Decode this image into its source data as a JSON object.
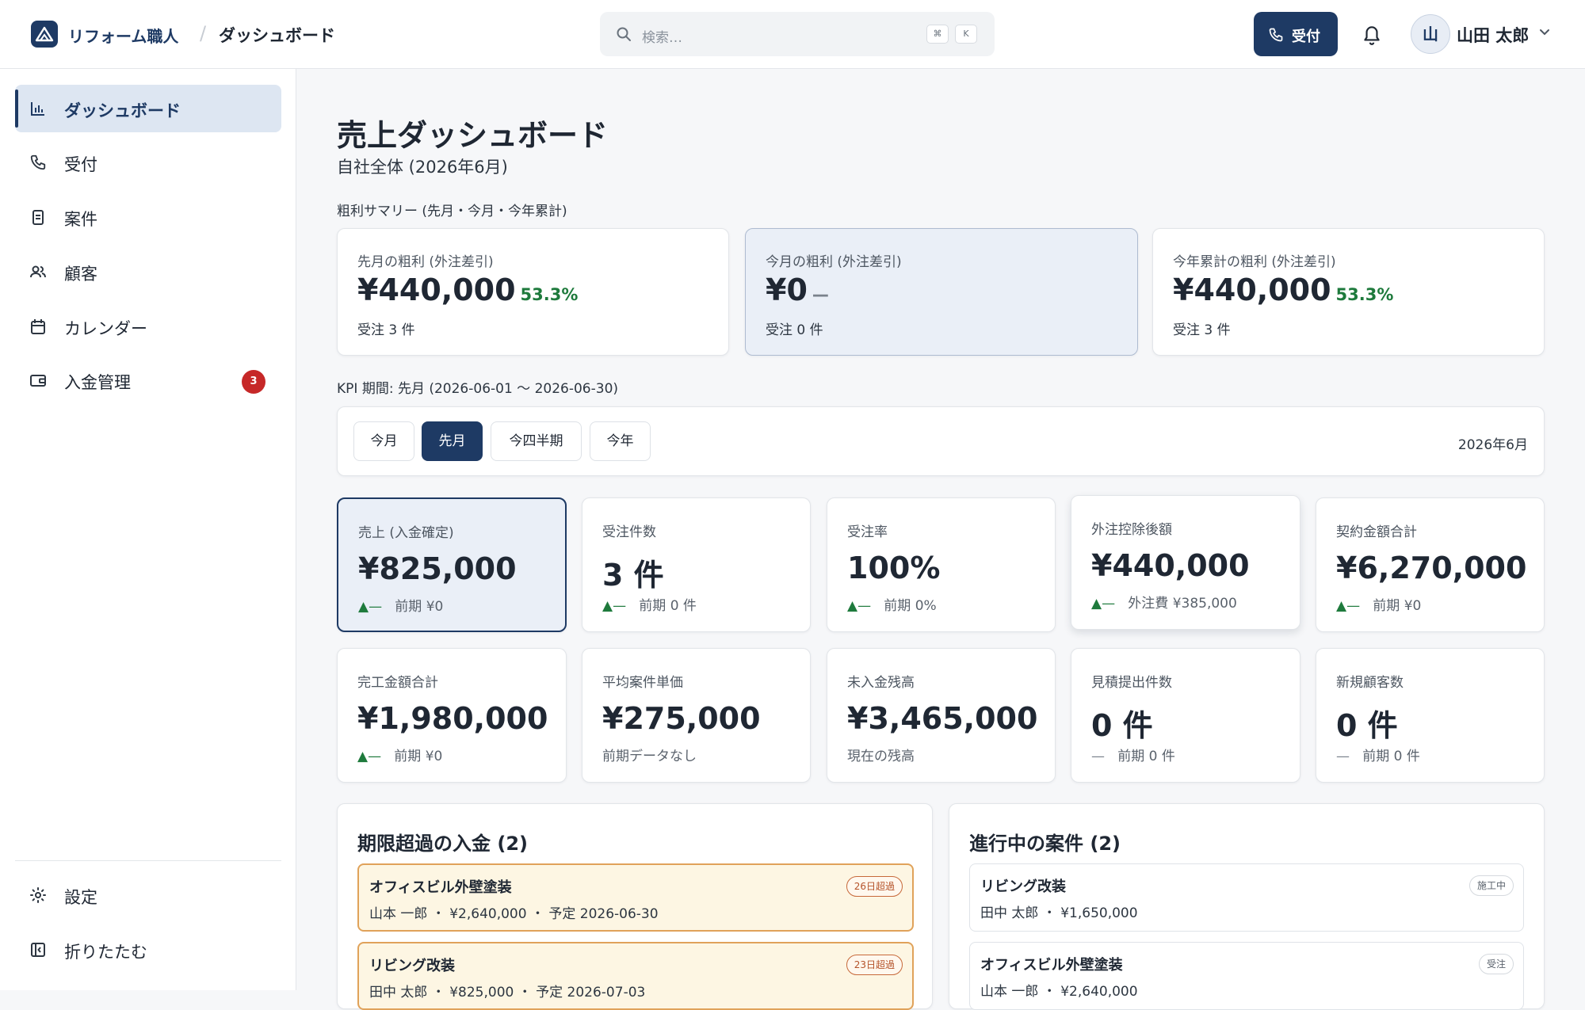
{
  "header": {
    "brand": "リフォーム職人",
    "breadcrumb_sep": "/",
    "page": "ダッシュボード",
    "search_placeholder": "検索…",
    "shortcut_key1": "⌘",
    "shortcut_key2": "K",
    "reception_label": "受付",
    "avatar_initial": "山",
    "user_name": "山田 太郎"
  },
  "sidebar": {
    "items": [
      {
        "label": "ダッシュボード",
        "icon": "bar-chart-icon"
      },
      {
        "label": "受付",
        "icon": "phone-icon"
      },
      {
        "label": "案件",
        "icon": "clipboard-icon"
      },
      {
        "label": "顧客",
        "icon": "users-icon"
      },
      {
        "label": "カレンダー",
        "icon": "calendar-icon"
      },
      {
        "label": "入金管理",
        "icon": "wallet-icon",
        "badge": "3"
      }
    ],
    "settings": "設定",
    "collapse": "折りたたむ"
  },
  "main": {
    "title": "売上ダッシュボード",
    "subtitle": "自社全体 (2026年6月)",
    "summary_label": "粗利サマリー (先月・今月・今年累計)",
    "summary_cards": [
      {
        "label": "先月の粗利 (外注差引)",
        "value": "¥440,000",
        "pct": "53.3%",
        "sub": "受注 3 件"
      },
      {
        "label": "今月の粗利 (外注差引)",
        "value": "¥0",
        "pct": "—",
        "sub": "受注 0 件"
      },
      {
        "label": "今年累計の粗利 (外注差引)",
        "value": "¥440,000",
        "pct": "53.3%",
        "sub": "受注 3 件"
      }
    ],
    "kpi_period_label": "KPI 期間: 先月 (2026-06-01 〜 2026-06-30)",
    "period_tabs": [
      "今月",
      "先月",
      "今四半期",
      "今年"
    ],
    "period_selected": "先月",
    "period_display": "2026年6月",
    "kpis": [
      {
        "label": "売上 (入金確定)",
        "value": "¥825,000",
        "trend": "▲—",
        "sub": "前期 ¥0"
      },
      {
        "label": "受注件数",
        "value": "3 件",
        "trend": "▲—",
        "sub": "前期 0 件"
      },
      {
        "label": "受注率",
        "value": "100%",
        "trend": "▲—",
        "sub": "前期 0%"
      },
      {
        "label": "外注控除後額",
        "value": "¥440,000",
        "trend": "▲—",
        "sub": "外注費 ¥385,000"
      },
      {
        "label": "契約金額合計",
        "value": "¥6,270,000",
        "trend": "▲—",
        "sub": "前期 ¥0"
      },
      {
        "label": "完工金額合計",
        "value": "¥1,980,000",
        "trend": "▲—",
        "sub": "前期 ¥0"
      },
      {
        "label": "平均案件単価",
        "value": "¥275,000",
        "trend": "",
        "sub": "前期データなし"
      },
      {
        "label": "未入金残高",
        "value": "¥3,465,000",
        "trend": "",
        "sub": "現在の残高"
      },
      {
        "label": "見積提出件数",
        "value": "0 件",
        "trend": "—",
        "sub": "前期 0 件"
      },
      {
        "label": "新規顧客数",
        "value": "0 件",
        "trend": "—",
        "sub": "前期 0 件"
      }
    ],
    "overdue_panel": {
      "title": "期限超過の入金 (2)",
      "items": [
        {
          "title": "オフィスビル外壁塗装",
          "sub": "山本 一郎 ・ ¥2,640,000 ・ 予定 2026-06-30",
          "badge": "26日超過"
        },
        {
          "title": "リビング改装",
          "sub": "田中 太郎 ・ ¥825,000 ・ 予定 2026-07-03",
          "badge": "23日超過"
        }
      ]
    },
    "progress_panel": {
      "title": "進行中の案件 (2)",
      "items": [
        {
          "title": "リビング改装",
          "sub": "田中 太郎 ・ ¥1,650,000",
          "badge": "施工中"
        },
        {
          "title": "オフィスビル外壁塗装",
          "sub": "山本 一郎 ・ ¥2,640,000",
          "badge": "受注"
        }
      ]
    }
  },
  "colors": {
    "primary": "#1e3a64",
    "positive": "#1e7a3c",
    "badge_red": "#c62828",
    "overdue_border": "#e0a25a"
  }
}
